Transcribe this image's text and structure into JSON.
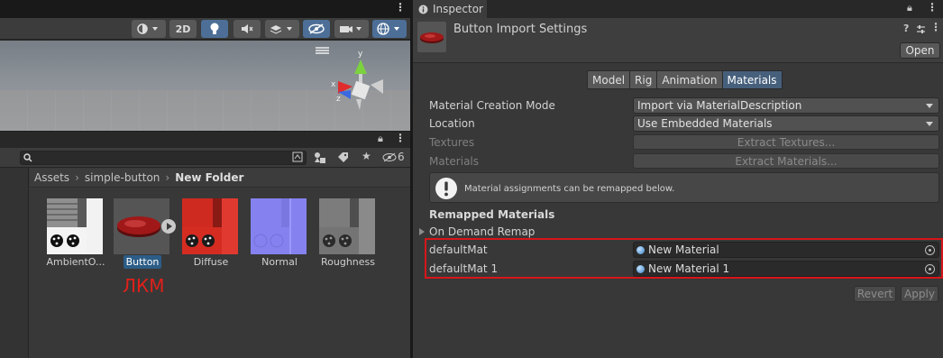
{
  "scene": {
    "toolbar": {
      "mode_2d": "2D"
    }
  },
  "project": {
    "breadcrumb": [
      "Assets",
      "simple-button",
      "New Folder"
    ],
    "hidden_count": "6",
    "assets": [
      {
        "label": "AmbientO...",
        "selected": false
      },
      {
        "label": "Button",
        "selected": true
      },
      {
        "label": "Diffuse",
        "selected": false
      },
      {
        "label": "Normal",
        "selected": false
      },
      {
        "label": "Roughness",
        "selected": false
      }
    ],
    "annotation": "ЛКМ"
  },
  "inspector": {
    "tab_title": "Inspector",
    "header_title": "Button Import Settings",
    "open_label": "Open",
    "tabs": [
      "Model",
      "Rig",
      "Animation",
      "Materials"
    ],
    "active_tab": "Materials",
    "material_creation_mode": {
      "label": "Material Creation Mode",
      "value": "Import via MaterialDescription"
    },
    "location": {
      "label": "Location",
      "value": "Use Embedded Materials"
    },
    "textures": {
      "label": "Textures",
      "button": "Extract Textures..."
    },
    "materials": {
      "label": "Materials",
      "button": "Extract Materials..."
    },
    "help_text": "Material assignments can be remapped below.",
    "remapped_title": "Remapped Materials",
    "on_demand_remap": "On Demand Remap",
    "remaps": [
      {
        "name": "defaultMat",
        "value": "New Material"
      },
      {
        "name": "defaultMat 1",
        "value": "New Material 1"
      }
    ],
    "revert_label": "Revert",
    "apply_label": "Apply"
  },
  "colors": {
    "accent": "#4d6f97",
    "highlight_box": "#d6161a",
    "annotation": "#e0201a",
    "selection": "#2c5d87"
  }
}
